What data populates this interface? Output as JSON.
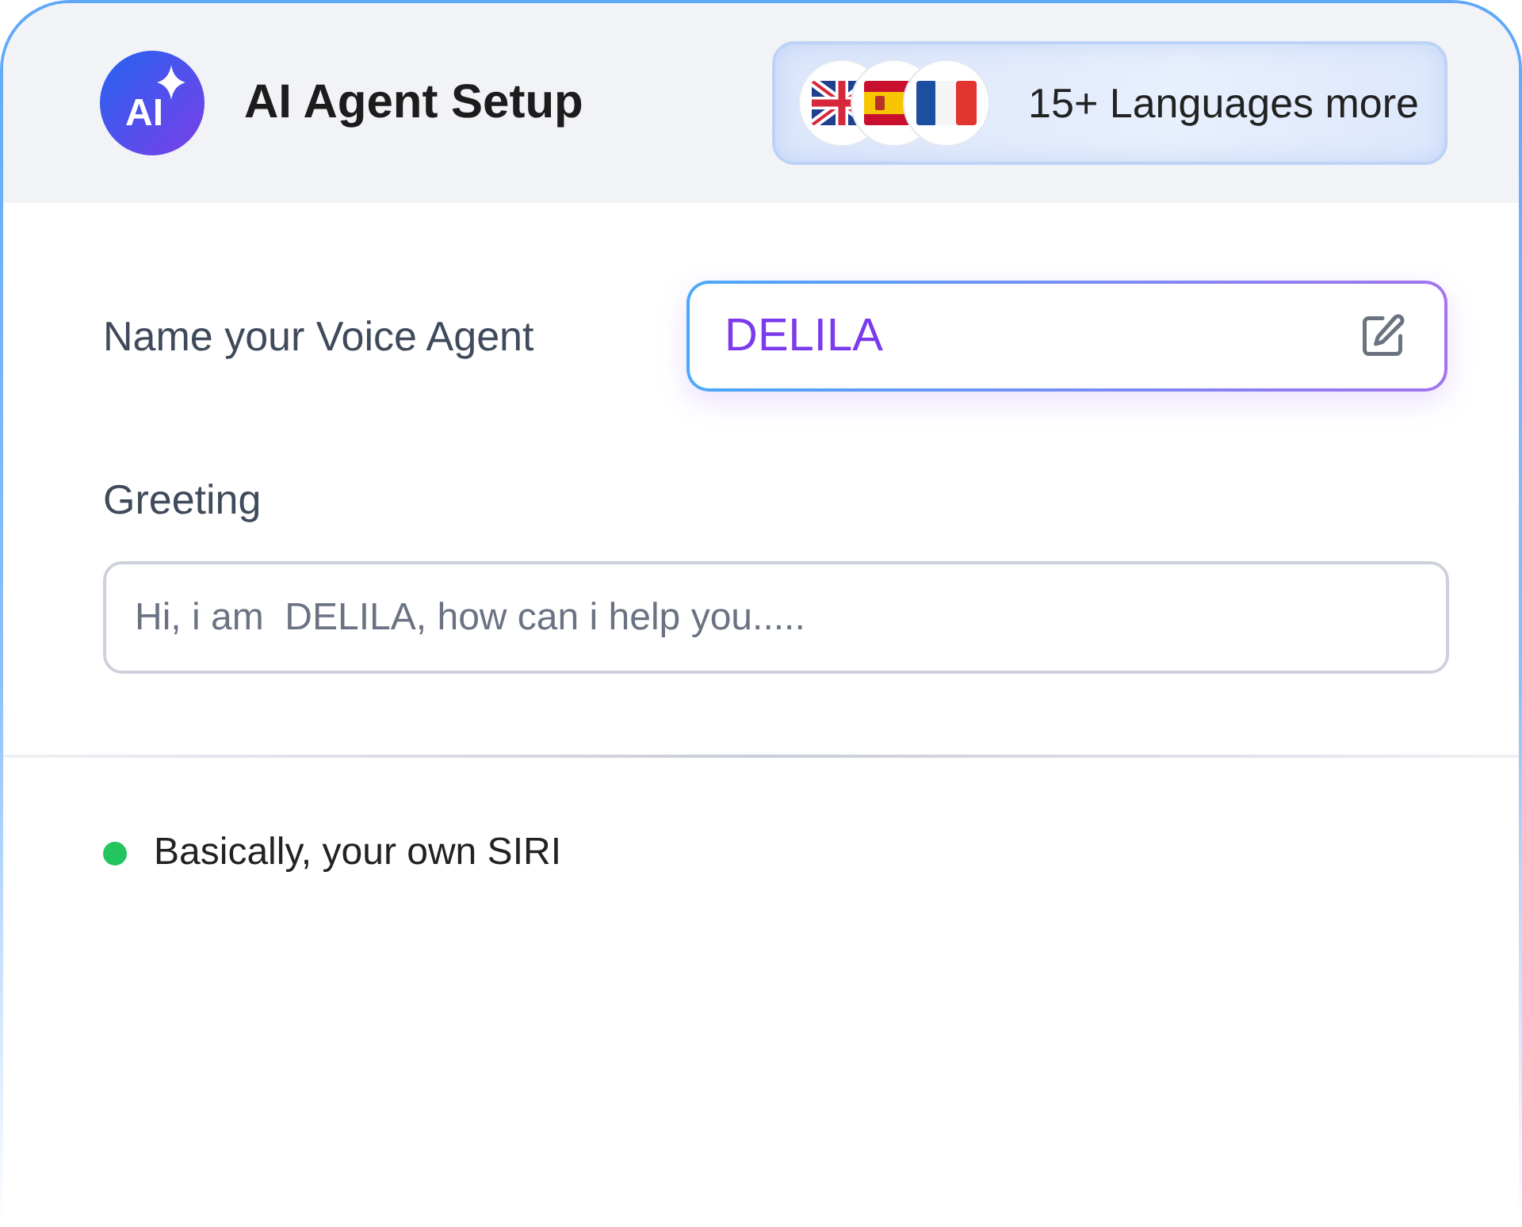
{
  "header": {
    "logo_text": "AI",
    "title": "AI Agent Setup",
    "languages": {
      "flags": [
        {
          "kind": "uk"
        },
        {
          "kind": "spain"
        },
        {
          "kind": "france"
        }
      ],
      "label": "15+ Languages more"
    }
  },
  "form": {
    "name": {
      "label": "Name your Voice Agent",
      "value": "DELILA"
    },
    "greeting": {
      "label": "Greeting",
      "value": "Hi, i am  DELILA, how can i help you....."
    }
  },
  "note": {
    "text": "Basically, your own SIRI",
    "color": "#22c55e"
  }
}
